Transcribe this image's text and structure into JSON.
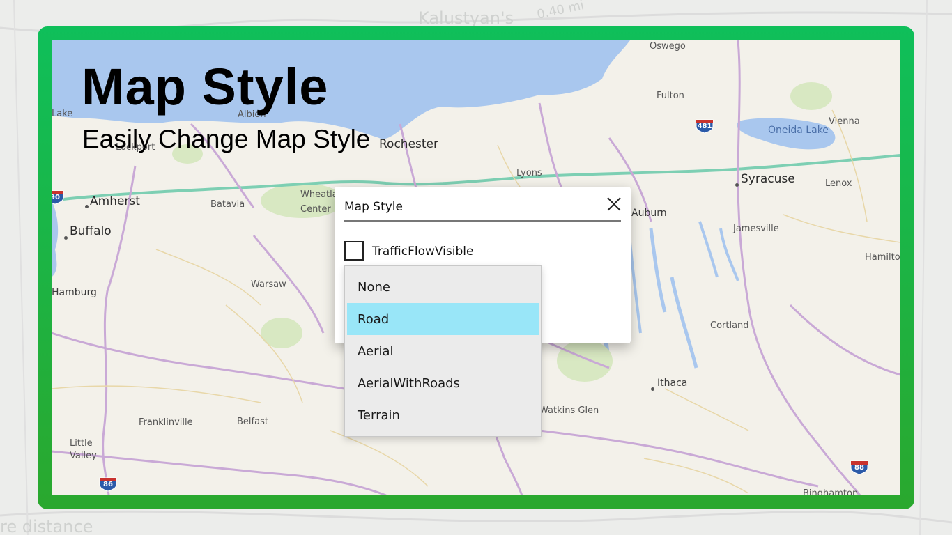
{
  "hero": {
    "title": "Map Style",
    "subtitle": "Easily Change Map Style"
  },
  "background_labels": [
    "Kalustyan's",
    "0.40 mi",
    "re distance"
  ],
  "map": {
    "places": [
      {
        "name": "Oswego",
        "size": "sm"
      },
      {
        "name": "Fulton",
        "size": "sm"
      },
      {
        "name": "Vienna",
        "size": "sm"
      },
      {
        "name": "Oneida Lake",
        "size": "water"
      },
      {
        "name": "Syracuse",
        "size": "big"
      },
      {
        "name": "Lenox",
        "size": "sm"
      },
      {
        "name": "Jamesville",
        "size": "sm"
      },
      {
        "name": "Hamilton",
        "size": "sm"
      },
      {
        "name": "Cortland",
        "size": "sm"
      },
      {
        "name": "Ithaca",
        "size": "med"
      },
      {
        "name": "Watkins Glen",
        "size": "sm"
      },
      {
        "name": "Binghamton",
        "size": "sm"
      },
      {
        "name": "Rochester",
        "size": "big"
      },
      {
        "name": "Lyons",
        "size": "sm"
      },
      {
        "name": "Auburn",
        "size": "med"
      },
      {
        "name": "Albion",
        "size": "sm"
      },
      {
        "name": "Lockport",
        "size": "sm"
      },
      {
        "name": "Amherst",
        "size": "big"
      },
      {
        "name": "Buffalo",
        "size": "big"
      },
      {
        "name": "Batavia",
        "size": "sm"
      },
      {
        "name": "Warsaw",
        "size": "sm"
      },
      {
        "name": "Hamburg",
        "size": "med"
      },
      {
        "name": "Franklinville",
        "size": "sm"
      },
      {
        "name": "Belfast",
        "size": "sm"
      },
      {
        "name": "Little Valley",
        "size": "sm"
      },
      {
        "name": "Lake",
        "size": "sm"
      },
      {
        "name": "Wheatland Center",
        "size": "sm"
      }
    ],
    "shields": [
      "481",
      "86",
      "88",
      "90"
    ],
    "colors": {
      "water": "#a9c7ee",
      "land": "#f3f1ea",
      "highway": "#7dcfb3",
      "road": "#c9a9d6",
      "park": "#cfe3b5"
    }
  },
  "dialog": {
    "title": "Map Style",
    "close_icon": "close-icon",
    "checkbox_label": "TrafficFlowVisible",
    "checkbox_checked": false
  },
  "dropdown": {
    "selected": "Road",
    "options": [
      "None",
      "Road",
      "Aerial",
      "AerialWithRoads",
      "Terrain"
    ]
  },
  "frame": {
    "border_color": "#1fb84a"
  }
}
